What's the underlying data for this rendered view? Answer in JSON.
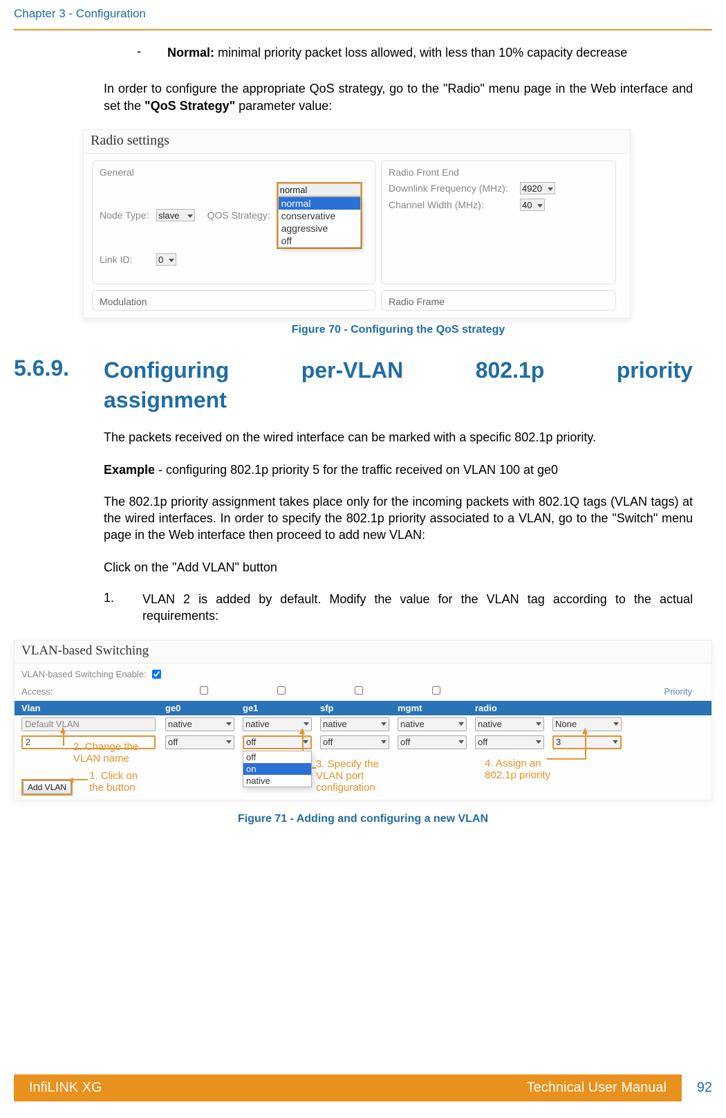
{
  "header": {
    "chapter": "Chapter 3 - Configuration"
  },
  "bullet": {
    "dash": "-",
    "normal_label": "Normal:",
    "normal_text": " minimal priority packet loss allowed, with less than 10% capacity decrease"
  },
  "para1_a": "In order to configure the appropriate QoS strategy, go to the \"Radio\" menu page in the Web interface and set the ",
  "para1_b": "\"QoS Strategy\"",
  "para1_c": " parameter value:",
  "shot1": {
    "title": "Radio settings",
    "general": "General",
    "node_type_label": "Node Type:",
    "node_type_value": "slave",
    "qos_label": "QOS Strategy:",
    "qos_value": "normal",
    "qos_opts": {
      "o1": "normal",
      "o2": "conservative",
      "o3": "aggressive",
      "o4": "off"
    },
    "link_id_label": "Link ID:",
    "link_id_value": "0",
    "rfe": "Radio Front End",
    "downlink_label": "Downlink Frequency (MHz):",
    "downlink_value": "4920",
    "cwidth_label": "Channel Width (MHz):",
    "cwidth_value": "40",
    "modulation": "Modulation",
    "radio_frame": "Radio Frame"
  },
  "caption1": "Figure 70 - Configuring the QoS strategy",
  "section": {
    "number": "5.6.9.",
    "w1": "Configuring",
    "w2": "per-VLAN",
    "w3": "802.1p",
    "w4": "priority",
    "w5": "assignment"
  },
  "para2": "The packets received on the wired interface can be marked with a specific 802.1p priority.",
  "example_label": "Example",
  "example_text": " - configuring 802.1p priority 5 for the traffic received on VLAN 100 at ge0",
  "para3": "The 802.1p priority assignment takes place only for the incoming packets with 802.1Q tags (VLAN tags) at the wired interfaces. In order to specify the 802.1p priority associated to a VLAN, go to the \"Switch\" menu page in the Web interface then proceed to add new VLAN:",
  "para4": "Click on the \"Add VLAN\" button",
  "ol": {
    "num": "1.",
    "text": "VLAN 2 is added by default. Modify the value for the VLAN tag according to the actual requirements:"
  },
  "shot2": {
    "title": "VLAN-based Switching",
    "enable_label": "VLAN-based Switching Enable:",
    "access_label": "Access:",
    "priority_label": "Priority",
    "head": {
      "vlan": "Vlan",
      "ge0": "ge0",
      "ge1": "ge1",
      "sfp": "sfp",
      "mgmt": "mgmt",
      "radio": "radio"
    },
    "row1": {
      "vlan": "Default VLAN",
      "c": "native",
      "priority": "None"
    },
    "row2": {
      "vlan": "2",
      "c": "off",
      "priority": "3",
      "drop": {
        "o1": "off",
        "o2": "on",
        "o3": "native"
      }
    },
    "add_btn": "Add VLAN",
    "anno1": "1. Click on\nthe button",
    "anno2": "2. Change the\nVLAN name",
    "anno3": "3. Specify the\nVLAN port\nconfiguration",
    "anno4": "4. Assign an\n802.1p priority"
  },
  "caption2": "Figure 71 - Adding and configuring a new VLAN",
  "footer": {
    "left": "InfiLINK XG",
    "right": "Technical User Manual",
    "page": "92"
  }
}
